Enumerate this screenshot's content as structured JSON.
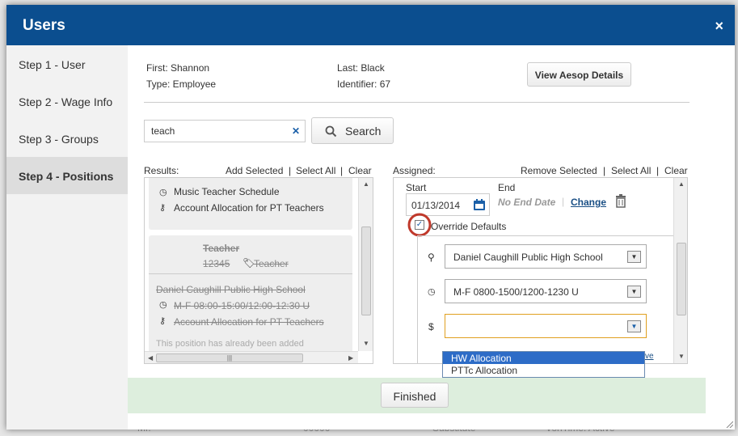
{
  "modal": {
    "title": "Users",
    "close_glyph": "×"
  },
  "sidebar": {
    "items": [
      {
        "label": "Step 1 - User"
      },
      {
        "label": "Step 2 - Wage Info"
      },
      {
        "label": "Step 3 - Groups"
      },
      {
        "label": "Step 4 - Positions"
      }
    ]
  },
  "user": {
    "first": "First: Shannon",
    "type": "Type: Employee",
    "last": "Last: Black",
    "identifier": "Identifier: 67",
    "view_button": "View Aesop Details"
  },
  "search": {
    "value": "teach",
    "clear_glyph": "✕",
    "button": "Search"
  },
  "results": {
    "label": "Results:",
    "add_selected": "Add Selected",
    "select_all": "Select All",
    "clear": "Clear",
    "sep": "|",
    "card1": {
      "schedule": "Music Teacher Schedule",
      "allocation": "Account Allocation for PT Teachers"
    },
    "card2": {
      "position": "Teacher",
      "number": "12345",
      "tag": "Teacher",
      "school": "Daniel Caughill Public High School",
      "schedule": "M-F 08:00-15:00/12:00-12:30 U",
      "allocation": "Account Allocation for PT Teachers",
      "note": "This position has already been added"
    },
    "scroll_thumb": "|||"
  },
  "assigned": {
    "label": "Assigned:",
    "remove_selected": "Remove Selected",
    "select_all": "Select All",
    "clear": "Clear",
    "start_label": "Start",
    "end_label": "End",
    "start_date": "01/13/2014",
    "end_date": "No End Date",
    "change": "Change",
    "override": "Override Defaults",
    "school": "Daniel Caughill Public High School",
    "schedule": "M-F 0800-1500/1200-1230 U",
    "allocation_value": "",
    "dollar": "$",
    "options": [
      "HW Allocation",
      "PTTc Allocation"
    ],
    "hidden_link": "ve"
  },
  "footer": {
    "finished": "Finished"
  },
  "background": {
    "col1": "Mr.",
    "col2": "00000",
    "col3": "Substitute",
    "col4": "VonTime: Active"
  }
}
